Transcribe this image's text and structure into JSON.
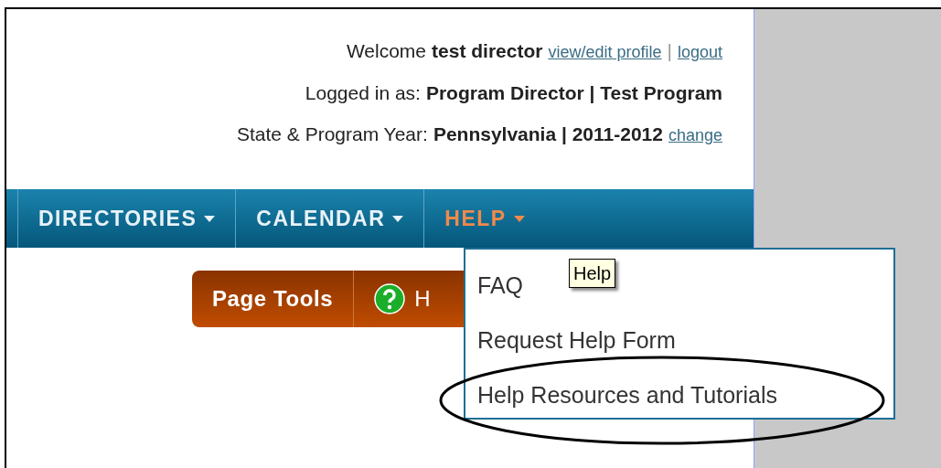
{
  "header": {
    "welcome": "Welcome",
    "user": "test director",
    "profile_link": "view/edit profile",
    "separator": "|",
    "logout_link": "logout",
    "role_label": "Logged in as:",
    "role": "Program Director | Test Program",
    "state_label": "State & Program Year:",
    "state": "Pennsylvania | 2011-2012",
    "change_link": "change"
  },
  "nav": [
    {
      "label": "DIRECTORIES",
      "selected": false
    },
    {
      "label": "CALENDAR",
      "selected": false
    },
    {
      "label": "HELP",
      "selected": true
    }
  ],
  "page_tools": {
    "label": "Page Tools",
    "help_button": "H"
  },
  "dropdown": [
    {
      "label": "FAQ",
      "circled": false
    },
    {
      "label": "Request Help Form",
      "circled": false
    },
    {
      "label": "Help Resources and Tutorials",
      "circled": true
    }
  ],
  "tooltip": "Help"
}
